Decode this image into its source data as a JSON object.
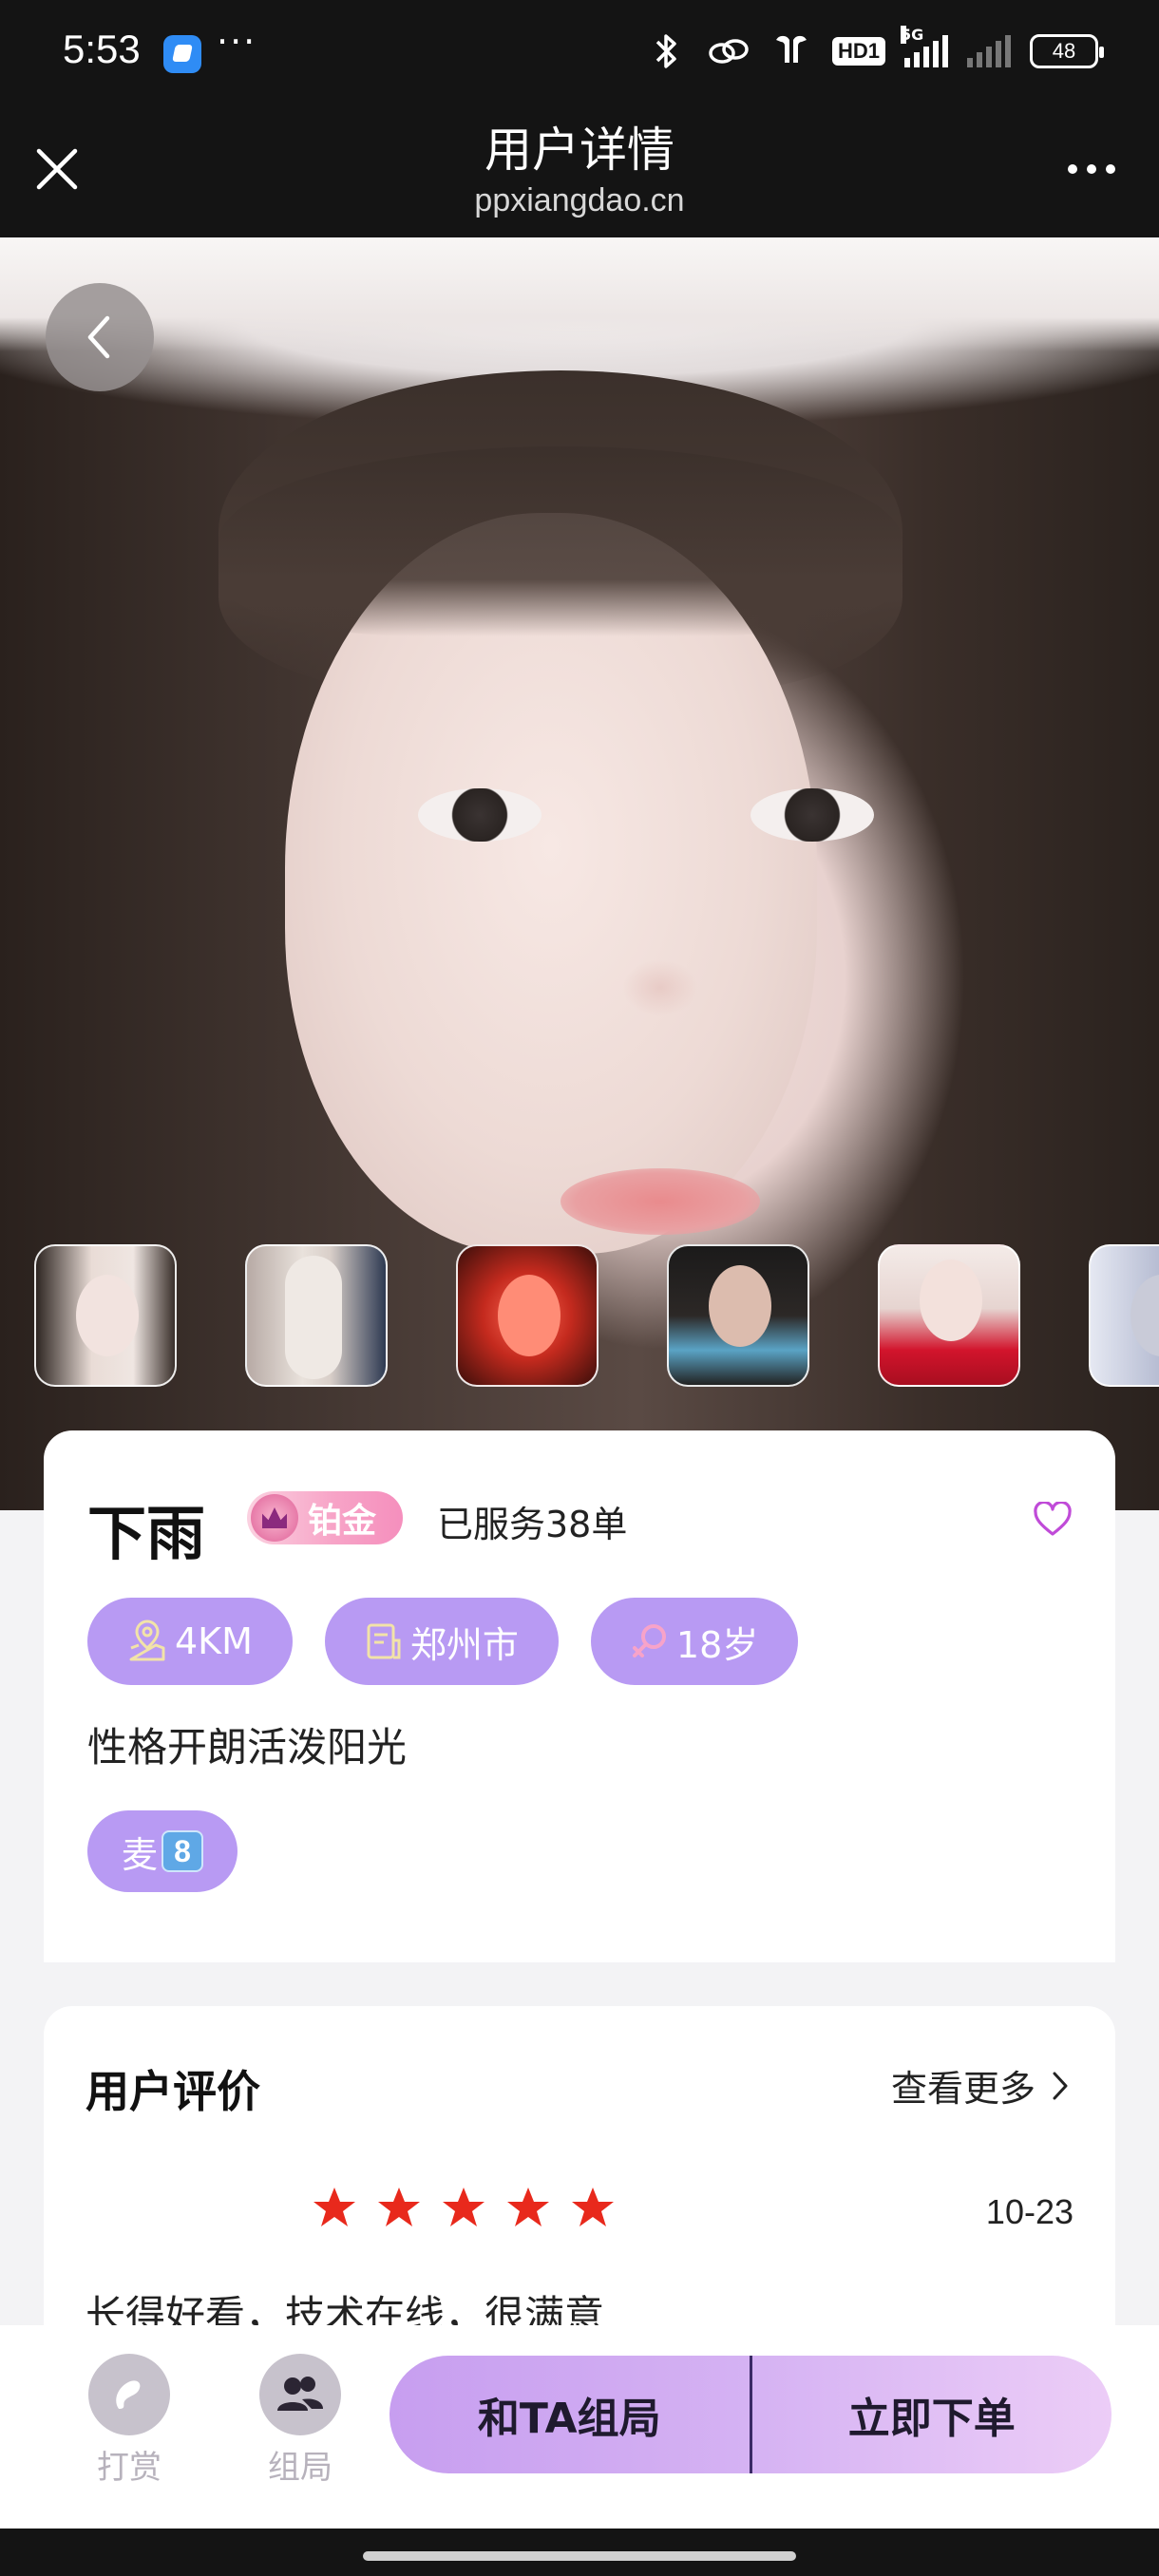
{
  "status_bar": {
    "time": "5:53",
    "more": "···",
    "hd_label": "HD1",
    "network_label": "5G",
    "battery": "48",
    "icons": [
      "bluetooth-icon",
      "link-icon",
      "earbuds-icon",
      "signal-icon",
      "battery-icon"
    ]
  },
  "title_bar": {
    "title": "用户详情",
    "subtitle": "ppxiangdao.cn"
  },
  "gallery": {
    "thumbnail_count_visible": 6
  },
  "profile": {
    "name": "下雨",
    "tier": "铂金",
    "served": "已服务38单",
    "chips": [
      {
        "icon": "location-icon",
        "label": "4KM"
      },
      {
        "icon": "city-icon",
        "label": "郑州市"
      },
      {
        "icon": "female-icon",
        "label": "18岁"
      }
    ],
    "bio": "性格开朗活泼阳光",
    "tag": {
      "label": "麦",
      "key": "8"
    }
  },
  "reviews": {
    "title": "用户评价",
    "more": "查看更多",
    "items": [
      {
        "stars": 5,
        "date": "10-23",
        "text": "长得好看，技术在线，很满意"
      }
    ]
  },
  "bottom_bar": {
    "tip_label": "打赏",
    "group_label": "组局",
    "cta_group": "和TA组局",
    "cta_order": "立即下单"
  },
  "colors": {
    "accent": "#b89af3",
    "star": "#e8291c",
    "tier_pink": "#f58fbd",
    "cta_start": "#c79ef0",
    "cta_end": "#eccdf7",
    "heart": "#c04bd8"
  }
}
